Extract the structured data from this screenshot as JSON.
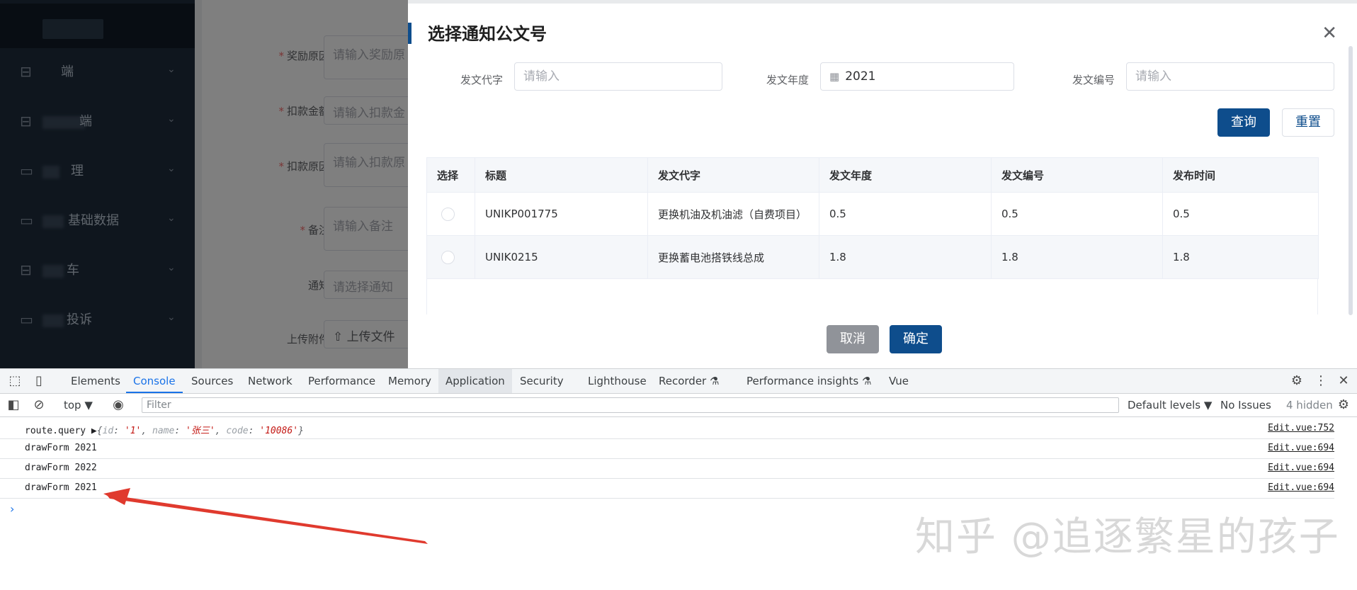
{
  "sidebar": {
    "items": [
      {
        "icon": "presentation-icon",
        "label": "端"
      },
      {
        "icon": "presentation-icon",
        "label": "端"
      },
      {
        "icon": "folder-icon",
        "label": "理"
      },
      {
        "icon": "folder-icon",
        "label": "基础数据"
      },
      {
        "icon": "presentation-icon",
        "label": "车"
      },
      {
        "icon": "folder-icon",
        "label": "投诉"
      }
    ]
  },
  "background_form": {
    "rows": [
      {
        "label": "奖励原因",
        "placeholder": "请输入奖励原"
      },
      {
        "label": "扣款金额",
        "placeholder": "请输入扣款金"
      },
      {
        "label": "扣款原因",
        "placeholder": "请输入扣款原"
      },
      {
        "label": "备注",
        "placeholder": "请输入备注"
      },
      {
        "label": "通知",
        "placeholder": "请选择通知"
      },
      {
        "label": "上传附件",
        "placeholder": "上传文件"
      }
    ]
  },
  "drawer": {
    "title": "选择通知公文号",
    "filters": [
      {
        "label": "发文代字",
        "placeholder": "请输入",
        "value": ""
      },
      {
        "label": "发文年度",
        "placeholder": "",
        "value": "2021"
      },
      {
        "label": "发文编号",
        "placeholder": "请输入",
        "value": ""
      }
    ],
    "search_label": "查询",
    "reset_label": "重置",
    "table": {
      "headers": [
        "选择",
        "标题",
        "发文代字",
        "发文年度",
        "发文编号",
        "发布时间"
      ],
      "rows": [
        [
          "",
          "UNIKP001775",
          "更换机油及机油滤（自费项目）",
          "0.5",
          "0.5",
          "0.5"
        ],
        [
          "",
          "UNIK0215",
          "更换蓄电池搭铁线总成",
          "1.8",
          "1.8",
          "1.8"
        ]
      ]
    },
    "cancel_label": "取消",
    "confirm_label": "确定"
  },
  "devtools": {
    "tabs": [
      "Elements",
      "Console",
      "Sources",
      "Network",
      "Performance",
      "Memory",
      "Application",
      "Security",
      "Lighthouse",
      "Recorder",
      "Performance insights",
      "Vue"
    ],
    "active_tab": "Console",
    "context": "top",
    "filter_placeholder": "Filter",
    "levels": "Default levels",
    "issues": "No Issues",
    "hidden": "4 hidden",
    "logs": [
      {
        "message": "route.query",
        "object": {
          "id": "'1'",
          "name": "'张三'",
          "code": "'10086'"
        },
        "source": "Edit.vue:752"
      },
      {
        "message": "drawForm 2021",
        "source": "Edit.vue:694"
      },
      {
        "message": "drawForm 2022",
        "source": "Edit.vue:694"
      },
      {
        "message": "drawForm 2021",
        "source": "Edit.vue:694"
      }
    ],
    "prompt": "›"
  },
  "watermark": "知乎 @追逐繁星的孩子",
  "colors": {
    "primary": "#0e4d8c",
    "sidebar": "#1f2d3d",
    "arrow": "#e03a2e"
  }
}
